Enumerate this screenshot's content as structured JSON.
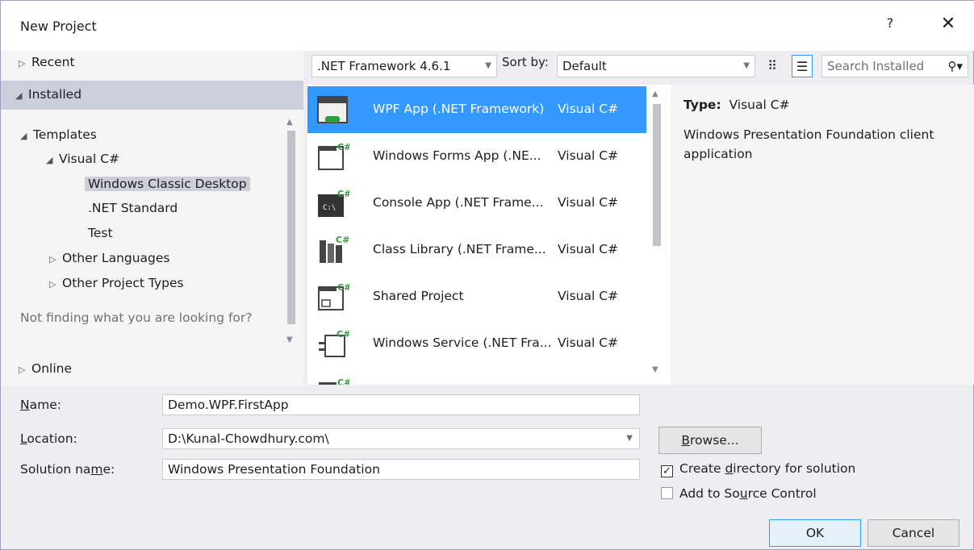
{
  "window": {
    "title": "New Project",
    "help_label": "?",
    "close_label": "✕"
  },
  "tree": {
    "recent": "Recent",
    "installed": "Installed",
    "templates": "Templates",
    "visual_csharp": "Visual C#",
    "windows_classic_desktop": "Windows Classic Desktop",
    "net_standard": ".NET Standard",
    "test": "Test",
    "other_languages": "Other Languages",
    "other_project_types": "Other Project Types",
    "hint": "Not finding what you are looking for?",
    "online": "Online"
  },
  "toolbar": {
    "framework": ".NET Framework 4.6.1",
    "sort_by_label": "Sort by:",
    "sort_by_value": "Default",
    "search_placeholder": "Search Installed"
  },
  "templates": [
    {
      "name": "WPF App (.NET Framework)",
      "lang": "Visual C#",
      "selected": true
    },
    {
      "name": "Windows Forms App (.NE...",
      "lang": "Visual C#"
    },
    {
      "name": "Console App (.NET Frame...",
      "lang": "Visual C#"
    },
    {
      "name": "Class Library (.NET Frame...",
      "lang": "Visual C#"
    },
    {
      "name": "Shared Project",
      "lang": "Visual C#"
    },
    {
      "name": "Windows Service (.NET Fra...",
      "lang": "Visual C#"
    }
  ],
  "description": {
    "type_label": "Type:",
    "type_value": "Visual C#",
    "text": "Windows Presentation Foundation client application"
  },
  "form": {
    "name_label_pre": "",
    "name_label_key": "N",
    "name_label_post": "ame:",
    "name_value": "Demo.WPF.FirstApp",
    "location_label_pre": "",
    "location_label_key": "L",
    "location_label_post": "ocation:",
    "location_value": "D:\\Kunal-Chowdhury.com\\",
    "solution_label_pre": "Solution na",
    "solution_label_key": "m",
    "solution_label_post": "e:",
    "solution_value": "Windows Presentation Foundation",
    "browse_pre": "",
    "browse_key": "B",
    "browse_post": "rowse...",
    "create_dir_pre": "Create ",
    "create_dir_key": "d",
    "create_dir_post": "irectory for solution",
    "create_dir_checked": true,
    "source_control_pre": "Add to So",
    "source_control_key": "u",
    "source_control_post": "rce Control",
    "source_control_checked": false,
    "ok_label": "OK",
    "cancel_label": "Cancel"
  }
}
